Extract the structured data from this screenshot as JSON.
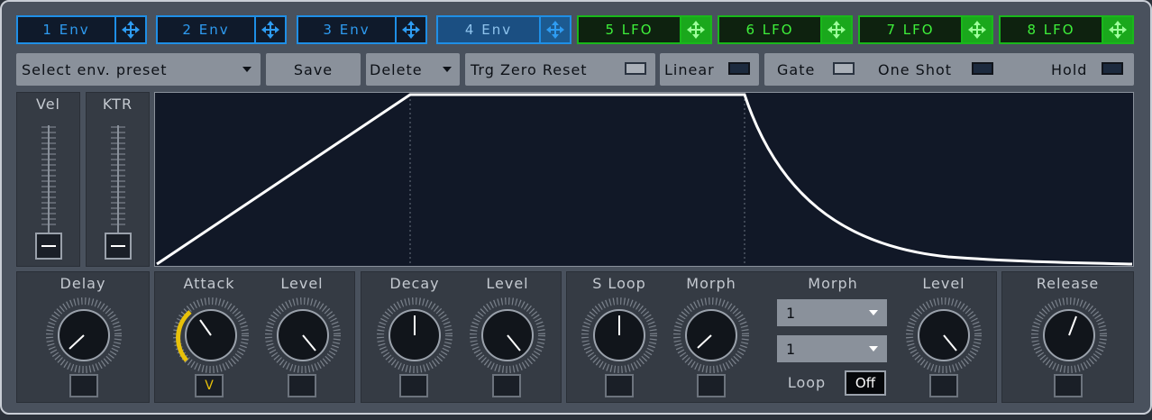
{
  "tabs": [
    {
      "label": "1 Env",
      "type": "env",
      "active": false
    },
    {
      "label": "2 Env",
      "type": "env",
      "active": false
    },
    {
      "label": "3 Env",
      "type": "env",
      "active": false
    },
    {
      "label": "4 Env",
      "type": "env",
      "active": true
    },
    {
      "label": "5 LFO",
      "type": "lfo",
      "active": false
    },
    {
      "label": "6 LFO",
      "type": "lfo",
      "active": false
    },
    {
      "label": "7 LFO",
      "type": "lfo",
      "active": false
    },
    {
      "label": "8 LFO",
      "type": "lfo",
      "active": false
    }
  ],
  "toolbar": {
    "preset_select": "Select env. preset",
    "save_label": "Save",
    "delete_label": "Delete",
    "trg_zero_reset": "Trg Zero Reset",
    "linear": "Linear",
    "gate": "Gate",
    "one_shot": "One Shot",
    "hold": "Hold"
  },
  "faders": {
    "vel_label": "Vel",
    "ktr_label": "KTR"
  },
  "controls": {
    "delay": "Delay",
    "attack": "Attack",
    "attack_level": "Level",
    "decay": "Decay",
    "decay_level": "Level",
    "s_loop": "S Loop",
    "morph_knob": "Morph",
    "morph_select": "Morph",
    "morph_value_1": "1",
    "morph_value_2": "1",
    "loop_label": "Loop",
    "loop_value": "Off",
    "morph_level": "Level",
    "release": "Release",
    "attack_mod_label": "V"
  },
  "colors": {
    "env_accent": "#1f8fe6",
    "lfo_accent": "#19b81b",
    "mod_indicator": "#e8c10a",
    "envelope_curve": "#ffffff"
  }
}
